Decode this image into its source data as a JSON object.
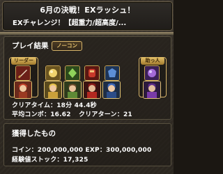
{
  "header": {
    "title": "6月の決戦！EXラッシュ！",
    "subtitle": "EXチャレンジ！【超重力/超高度/..."
  },
  "result": {
    "title": "プレイ結果",
    "badge": "ノーコン",
    "leader_label": "リーダー",
    "friend_label": "助っ人",
    "clear_time": "クリアタイム：18分 44.4秒",
    "avg_combo": "平均コンボ：16.62",
    "clear_turn": "クリアターン：21",
    "team": [
      {
        "slot": "leader",
        "icon": "red-haired-warrior-portrait-icon"
      },
      {
        "slot": "sub-1",
        "icon": "golden-knight-portrait-icon"
      },
      {
        "slot": "sub-2",
        "icon": "green-warrior-portrait-icon"
      },
      {
        "slot": "sub-3",
        "icon": "dark-red-knight-portrait-icon"
      },
      {
        "slot": "sub-4",
        "icon": "blue-haired-mage-portrait-icon"
      },
      {
        "slot": "friend",
        "icon": "purple-dark-mage-portrait-icon"
      }
    ],
    "assists": [
      {
        "slot": "leader",
        "icon": "red-sword-assist-icon"
      },
      {
        "slot": "sub-1",
        "icon": "gold-orb-assist-icon"
      },
      {
        "slot": "sub-2",
        "icon": "green-orb-assist-icon"
      },
      {
        "slot": "sub-3",
        "icon": "red-armor-assist-icon"
      },
      {
        "slot": "sub-4",
        "icon": "blue-armor-assist-icon"
      },
      {
        "slot": "friend",
        "icon": "purple-orb-assist-icon"
      }
    ]
  },
  "rewards": {
    "title": "獲得したもの",
    "coin_exp": "コイン：200,000,000  EXP：300,000,000",
    "exp_stock": "経験値ストック：17,325"
  }
}
